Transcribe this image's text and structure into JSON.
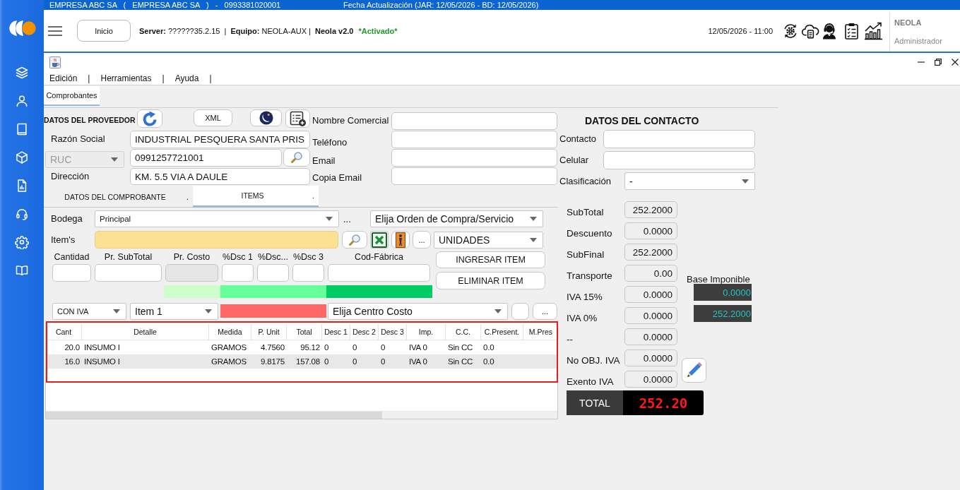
{
  "banner": {
    "company": "EMPRESA ABC SA   (   EMPRESA ABC SA   )   -   0993381020001",
    "updated": "Fecha Actualización (JAR: 12/05/2026 - BD: 12/05/2026)"
  },
  "header": {
    "home_button": "Inicio",
    "server_info": "**Server:** ??????35.2.15  |  **Equipo:** NEOLA-AUX |  **Neola v2.0**",
    "status": "*Activado*",
    "datetime": "12/05/2026 - 11:00",
    "user": {
      "name": "NEOLA",
      "role": "Administrador"
    }
  },
  "window": {
    "menu": [
      {
        "label": "Edición",
        "separator": "|"
      },
      {
        "label": "Herramientas",
        "separator": "|"
      },
      {
        "label": "Ayuda",
        "separator": "|"
      }
    ],
    "tabs": [
      {
        "label": "Comprobantes",
        "selected": true
      }
    ]
  },
  "proveedor": {
    "title": "DATOS DEL PROVEEDOR",
    "xml_button": "XML",
    "razon_social": {
      "label": "Razón Social",
      "value": "INDUSTRIAL PESQUERA SANTA PRIS"
    },
    "id_type": {
      "value": "RUC",
      "disabled": true
    },
    "ruc": {
      "value": "0991257721001"
    },
    "direccion": {
      "label": "Dirección",
      "value": "KM. 5.5 VIA A DAULE"
    }
  },
  "comercial": {
    "fields": [
      {
        "label": "Nombre Comercial"
      },
      {
        "label": "Teléfono"
      },
      {
        "label": "Email"
      },
      {
        "label": "Copia Email"
      }
    ]
  },
  "contacto": {
    "title": "DATOS DEL CONTACTO",
    "fields": [
      {
        "label": "Contacto"
      },
      {
        "label": "Celular"
      }
    ],
    "clasificacion": {
      "label": "Clasificación",
      "value": "-"
    }
  },
  "subtabs": [
    {
      "label": "DATOS DEL COMPROBANTE",
      "suffix": ".",
      "selected": false
    },
    {
      "label": "ITEMS",
      "suffix": ".",
      "selected": true
    }
  ],
  "items_panel": {
    "bodega": {
      "label": "Bodega",
      "value": "Principal"
    },
    "bodega_more": "...",
    "orden": {
      "value": "Elija Orden de Compra/Servicio"
    },
    "item": {
      "label": "Item's"
    },
    "more_button": "...",
    "unidad": {
      "value": "UNIDADES"
    },
    "entry_fields": [
      {
        "label": "Cantidad",
        "disabled": false
      },
      {
        "label": "Pr. SubTotal",
        "disabled": false
      },
      {
        "label": "Pr. Costo",
        "disabled": true
      },
      {
        "label": "%Dsc 1",
        "disabled": false
      },
      {
        "label": "%Dsc...",
        "disabled": false
      },
      {
        "label": "%Dsc 3",
        "disabled": false
      },
      {
        "label": "Cod-Fábrica",
        "disabled": false
      }
    ],
    "add_button": "INGRESAR ITEM",
    "remove_button": "ELIMINAR ITEM",
    "indicators": [
      {
        "color": "#ccffcc"
      },
      {
        "color": "#66ff99"
      },
      {
        "color": "#00cc66"
      }
    ],
    "iva_mode": {
      "value": "CON IVA"
    },
    "item_select": {
      "value": "Item 1"
    },
    "alert_indicator": {
      "color": "#ff6666"
    },
    "centro_costo": {
      "value": "Elija Centro Costo"
    },
    "cc_more_button": "..."
  },
  "table": {
    "highlighted": true,
    "columns": [
      {
        "label": "Cant",
        "kind": "number"
      },
      {
        "label": "Detalle",
        "kind": "text"
      },
      {
        "label": "Medida",
        "kind": "text"
      },
      {
        "label": "P. Unit",
        "kind": "number"
      },
      {
        "label": "Total",
        "kind": "number"
      },
      {
        "label": "Desc 1",
        "kind": "text"
      },
      {
        "label": "Desc 2",
        "kind": "text"
      },
      {
        "label": "Desc 3",
        "kind": "text"
      },
      {
        "label": "Imp.",
        "kind": "text"
      },
      {
        "label": "C.C.",
        "kind": "text"
      },
      {
        "label": "C.Present.",
        "kind": "text"
      },
      {
        "label": "M.Pres",
        "kind": "text"
      }
    ],
    "rows": [
      [
        "20.0",
        "INSUMO I",
        "GRAMOS",
        "4.7560",
        "95.12",
        "0",
        "0",
        "0",
        "IVA 0",
        "Sin CC",
        "0.0"
      ],
      [
        "16.0",
        "INSUMO I",
        "GRAMOS",
        "9.8175",
        "157.08",
        "0",
        "0",
        "0",
        "IVA 0",
        "Sin CC",
        "0.0"
      ]
    ]
  },
  "totales": {
    "rows": [
      {
        "label": "SubTotal",
        "value": "252.2000"
      },
      {
        "label": "Descuento",
        "value": "0.0000"
      },
      {
        "label": "SubFinal",
        "value": "252.2000"
      },
      {
        "label": "Transporte",
        "value": "0.00"
      },
      {
        "label": "IVA 15%",
        "value": "0.0000"
      },
      {
        "label": "IVA 0%",
        "value": "0.0000"
      },
      {
        "label": "--",
        "value": "0.0000"
      },
      {
        "label": "No OBJ. IVA",
        "value": "0.0000"
      },
      {
        "label": "Exento IVA",
        "value": "0.0000"
      }
    ],
    "base_imponible": {
      "label": "Base Imponible",
      "values": [
        "0.0000",
        "252.2000"
      ]
    },
    "total": {
      "label": "TOTAL",
      "value": "252.20"
    }
  }
}
